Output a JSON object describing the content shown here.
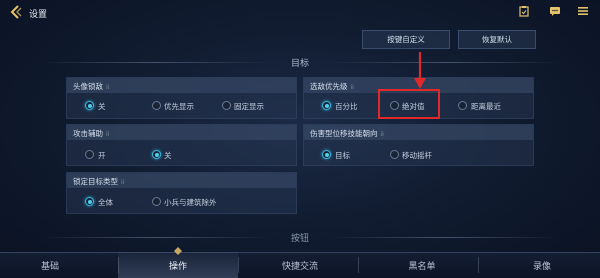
{
  "header": {
    "title": "设置",
    "icons": [
      "back-icon",
      "clipboard-icon",
      "chat-icon",
      "menu-icon"
    ]
  },
  "actions": {
    "custom_keys": "按键自定义",
    "restore_default": "恢复默认"
  },
  "section_target": "目标",
  "section_button": "按钮",
  "cards": {
    "avatar_lock": {
      "title": "头像锁敌",
      "options": [
        "关",
        "优先显示",
        "固定显示"
      ],
      "selected": "关"
    },
    "target_priority": {
      "title": "选敌优先级",
      "options": [
        "百分比",
        "绝对值",
        "距离最近"
      ],
      "selected": "百分比"
    },
    "attack_assist": {
      "title": "攻击辅助",
      "options": [
        "开",
        "关"
      ],
      "selected": "关"
    },
    "skill_direction": {
      "title": "伤害型位移技能朝向",
      "options": [
        "目标",
        "移动摇杆"
      ],
      "selected": "目标"
    },
    "lock_target_type": {
      "title": "锁定目标类型",
      "options": [
        "全体",
        "小兵与建筑除外"
      ],
      "selected": "全体"
    }
  },
  "info_marker": "ii",
  "annotation": {
    "color": "#e02a2a",
    "highlighted_option": "绝对值"
  },
  "nav": {
    "items": [
      "基础",
      "操作",
      "快捷交流",
      "黑名单",
      "录像"
    ],
    "active": "操作"
  },
  "colors": {
    "accent": "#36b5d6",
    "background": "#111c31"
  }
}
